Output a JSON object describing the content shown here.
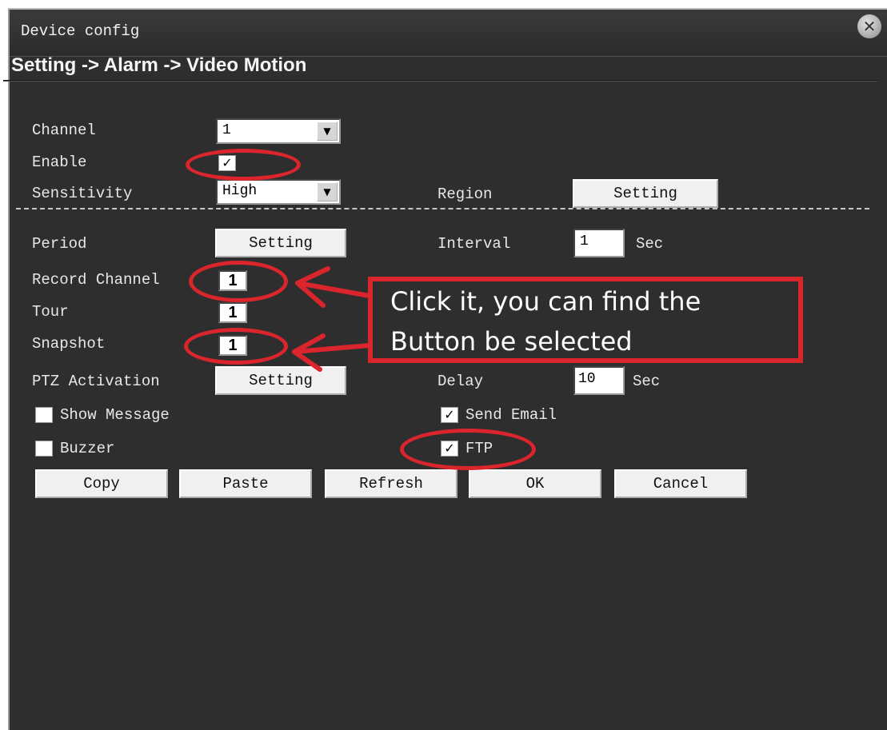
{
  "window": {
    "title": "Device config",
    "close_icon": "close-icon"
  },
  "breadcrumb": "Setting -> Alarm -> Video Motion",
  "form": {
    "channel": {
      "label": "Channel",
      "value": "1"
    },
    "enable": {
      "label": "Enable",
      "checked": true
    },
    "sensitivity": {
      "label": "Sensitivity",
      "value": "High"
    },
    "region": {
      "label": "Region",
      "button": "Setting"
    },
    "period": {
      "label": "Period",
      "button": "Setting"
    },
    "interval": {
      "label": "Interval",
      "value": "1",
      "unit": "Sec"
    },
    "record_channel": {
      "label": "Record Channel",
      "value": "1"
    },
    "tour": {
      "label": "Tour",
      "value": "1"
    },
    "snapshot": {
      "label": "Snapshot",
      "value": "1"
    },
    "ptz_activation": {
      "label": "PTZ Activation",
      "button": "Setting"
    },
    "delay": {
      "label": "Delay",
      "value": "10",
      "unit": "Sec"
    },
    "show_message": {
      "label": "Show Message",
      "checked": false
    },
    "send_email": {
      "label": "Send Email",
      "checked": true
    },
    "buzzer": {
      "label": "Buzzer",
      "checked": false
    },
    "ftp": {
      "label": "FTP",
      "checked": true
    }
  },
  "buttons": {
    "copy": "Copy",
    "paste": "Paste",
    "refresh": "Refresh",
    "ok": "OK",
    "cancel": "Cancel"
  },
  "annotation": {
    "line1": "Click it, you can find the",
    "line2": "Button be selected",
    "color": "#d9252b"
  },
  "colors": {
    "background": "#2e2e2e",
    "text": "#e8e8e8"
  }
}
